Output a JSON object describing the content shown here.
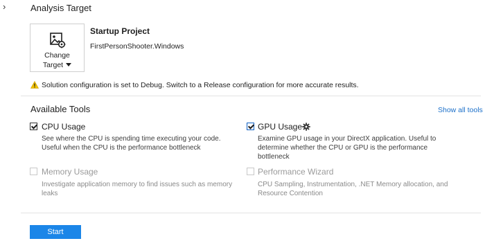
{
  "analysis_target": {
    "title": "Analysis Target",
    "change_target_label": "Change",
    "change_target_label2": "Target",
    "startup_title": "Startup Project",
    "startup_value": "FirstPersonShooter.Windows",
    "warning": "Solution configuration is set to Debug. Switch to a Release configuration for more accurate results."
  },
  "available_tools": {
    "title": "Available Tools",
    "show_all_label": "Show all tools",
    "tools": [
      {
        "name": "CPU Usage",
        "checked": true,
        "enabled": true,
        "desc1": "See where the CPU is spending time executing your code.",
        "desc2": "Useful when the CPU is the performance bottleneck",
        "desc3": ""
      },
      {
        "name": "GPU Usage",
        "checked": true,
        "enabled": true,
        "has_settings": true,
        "desc1": "Examine GPU usage in your DirectX application. Useful to",
        "desc2": "determine whether the CPU or GPU is the performance",
        "desc3": "bottleneck"
      },
      {
        "name": "Memory Usage",
        "checked": false,
        "enabled": false,
        "desc1": "Investigate application memory to find issues such as memory",
        "desc2": "leaks",
        "desc3": ""
      },
      {
        "name": "Performance Wizard",
        "checked": false,
        "enabled": false,
        "desc1": "CPU Sampling, Instrumentation, .NET Memory allocation, and",
        "desc2": "Resource Contention",
        "desc3": ""
      }
    ]
  },
  "start_label": "Start",
  "colors": {
    "accent": "#1b86e8",
    "link": "#1a6fc9",
    "warning": "#f2c200"
  }
}
